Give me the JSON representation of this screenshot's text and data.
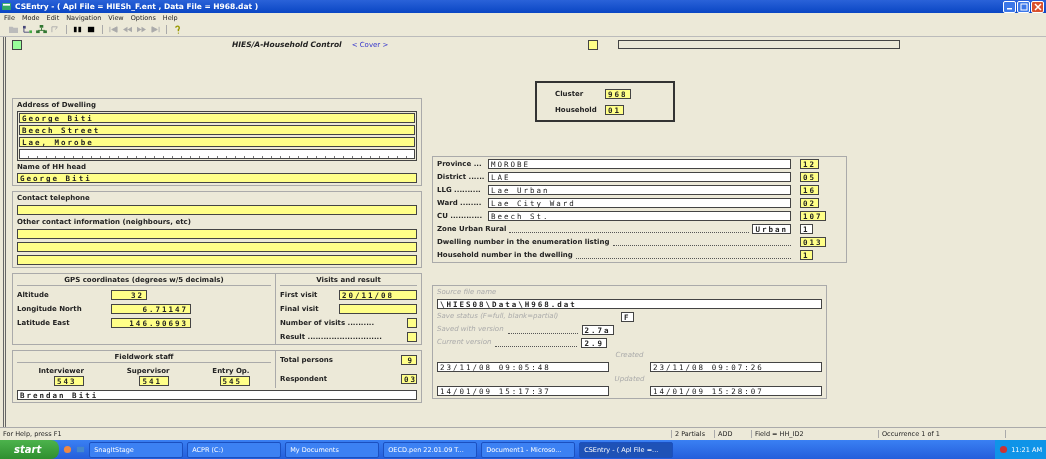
{
  "window": {
    "title": "CSEntry - ( Apl File = HIESh_F.ent , Data File = H968.dat )"
  },
  "menu": [
    "File",
    "Mode",
    "Edit",
    "Navigation",
    "View",
    "Options",
    "Help"
  ],
  "form": {
    "title": "HIES/A-Household Control",
    "link": "< Cover >"
  },
  "address": {
    "label": "Address of Dwelling",
    "lines": [
      {
        "value": "George Biti",
        "highlighted": true
      },
      {
        "value": "Beech Street",
        "highlighted": true
      },
      {
        "value": "Lae, Morobe",
        "highlighted": true
      },
      {
        "highlighted": false
      }
    ],
    "head_label": "Name of HH head",
    "head": {
      "value": "George Biti",
      "highlighted": true
    }
  },
  "contact": {
    "telephone_label": "Contact telephone",
    "telephone": {
      "highlighted": true
    },
    "other_label": "Other contact information (neighbours, etc)",
    "other_lines": [
      {
        "highlighted": true
      },
      {
        "highlighted": true
      },
      {
        "highlighted": true
      }
    ]
  },
  "gps": {
    "title": "GPS coordinates  (degrees w/5 decimals)",
    "rows": [
      {
        "label": "Altitude",
        "value": "32"
      },
      {
        "label": "Longitude North",
        "value": "6.71147"
      },
      {
        "label": "Latitude East",
        "value": "146.90693"
      }
    ]
  },
  "visits": {
    "title": "Visits and result",
    "rows": [
      {
        "label": "First visit",
        "value": "20/11/08",
        "kind": "date"
      },
      {
        "label": "Final visit",
        "kind": "date"
      },
      {
        "label": "Number of visits ..........",
        "kind": "short"
      },
      {
        "label": "Result ............................",
        "kind": "short"
      }
    ]
  },
  "staff": {
    "title": "Fieldwork staff",
    "members": [
      {
        "role": "Interviewer",
        "code": "543"
      },
      {
        "role": "Supervisor",
        "code": "541"
      },
      {
        "role": "Entry Op.",
        "code": "545"
      }
    ],
    "name": "Brendan Biti"
  },
  "totals": [
    {
      "label": "Total persons",
      "value": "9"
    },
    {
      "label": "Respondent",
      "value": "03"
    }
  ],
  "id": {
    "rows": [
      {
        "label": "Cluster",
        "value": "968"
      },
      {
        "label": "Household",
        "value": "01"
      }
    ]
  },
  "geo": {
    "rows": [
      {
        "kind": "named",
        "label": "Province ...",
        "name": "MOROBE",
        "code": "12",
        "highlighted": true
      },
      {
        "kind": "named",
        "label": "District ......",
        "name": "LAE",
        "code": "05",
        "highlighted": true
      },
      {
        "kind": "named",
        "label": "LLG ..........",
        "name": "Lae Urban",
        "code": "16",
        "highlighted": true
      },
      {
        "kind": "named",
        "label": "Ward ........",
        "name": "Lae City Ward",
        "code": "02",
        "highlighted": true
      },
      {
        "kind": "named",
        "label": "CU ............",
        "name": "Beech St.",
        "code": "107",
        "highlighted": true
      },
      {
        "kind": "short",
        "label": "Zone Urban Rural",
        "name": "Urban",
        "code": "1",
        "highlighted": false
      },
      {
        "kind": "code",
        "label": "Dwelling number in the enumeration listing",
        "code": "013",
        "highlighted": true
      },
      {
        "kind": "code",
        "label": "Household number in the dwelling",
        "code": "1",
        "highlighted": true
      }
    ]
  },
  "source": {
    "file_label": "Source file name",
    "file": "\\HIES08\\Data\\H968.dat",
    "save_label": "Save status (F=full, blank=partial)",
    "save": "F",
    "saved_label": "Saved with version",
    "saved": "2.7a",
    "current_label": "Current version",
    "current": "2.9",
    "created_label": "Created",
    "created": [
      "23/11/08  09:05:48",
      "23/11/08  09:07:26"
    ],
    "updated_label": "Updated",
    "updated": [
      "14/01/09  15:17:37",
      "14/01/09  15:28:07"
    ]
  },
  "status_bar": [
    "For Help, press F1",
    "2 Partials",
    "ADD",
    "Field = HH_ID2",
    "Occurrence 1 of 1"
  ],
  "taskbar": {
    "start": "start",
    "tasks": [
      {
        "label": "SnagItStage",
        "selected": false
      },
      {
        "label": "ACPR (C:)",
        "selected": false
      },
      {
        "label": "My Documents",
        "selected": false
      },
      {
        "label": "OECD.pen 22.01.09 T...",
        "selected": false
      },
      {
        "label": "Document1 - Microso...",
        "selected": false
      },
      {
        "label": "CSEntry - ( Apl File =...",
        "selected": true
      }
    ],
    "clock": "11:21 AM"
  }
}
